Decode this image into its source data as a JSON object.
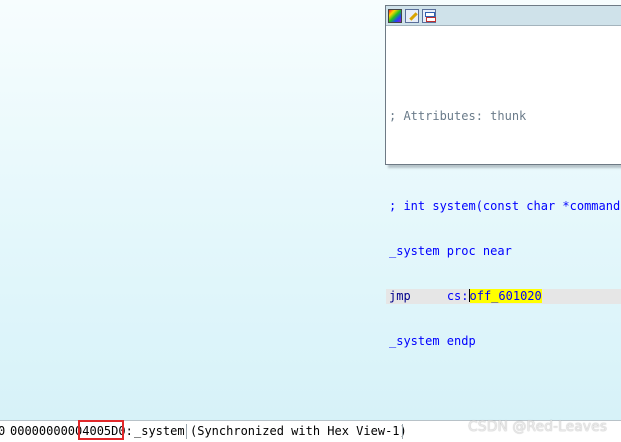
{
  "graph_view": {
    "node": {
      "toolbar_icons": [
        "color-palette-icon",
        "rename-icon",
        "graph-overview-icon"
      ],
      "lines": {
        "attributes_comment": "; Attributes: thunk",
        "prototype_comment": "; int system(const char *command)",
        "proc_start": "_system proc near",
        "instr_mnemonic": "jmp",
        "instr_segment": "cs:",
        "instr_symbol": "off_601020",
        "proc_end": "_system endp"
      }
    }
  },
  "status_bar": {
    "prefix_fragment": "0",
    "address_left": "0000000000",
    "address_highlighted": "4005D0",
    "address_suffix": ":",
    "function_name": "_system",
    "sync_text": "(Synchronized with Hex View-1)"
  },
  "watermark": "CSDN @Red-Leaves",
  "colors": {
    "highlight_box": "#e0282a",
    "symbol_highlight": "#ffff00",
    "code_text": "#0000ff"
  }
}
